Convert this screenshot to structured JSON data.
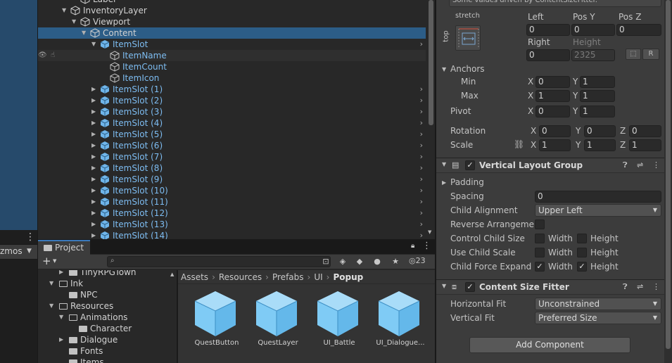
{
  "scene": {
    "gizmos_label": "zmos"
  },
  "hierarchy": {
    "rows": [
      {
        "label": "Label",
        "type": "go",
        "depth": 5,
        "fold": ""
      },
      {
        "label": "InventoryLayer",
        "type": "go",
        "depth": 4,
        "fold": "down"
      },
      {
        "label": "Viewport",
        "type": "go",
        "depth": 5,
        "fold": "down"
      },
      {
        "label": "Content",
        "type": "go",
        "depth": 6,
        "fold": "down",
        "selected": true
      },
      {
        "label": "ItemSlot",
        "type": "prefab",
        "depth": 7,
        "fold": "down",
        "chevron": true
      },
      {
        "label": "ItemName",
        "type": "prefab-child",
        "depth": 8,
        "fold": "",
        "hover": true
      },
      {
        "label": "ItemCount",
        "type": "prefab-child",
        "depth": 8,
        "fold": ""
      },
      {
        "label": "ItemIcon",
        "type": "prefab-child",
        "depth": 8,
        "fold": ""
      },
      {
        "label": "ItemSlot (1)",
        "type": "prefab",
        "depth": 7,
        "fold": "right",
        "chevron": true
      },
      {
        "label": "ItemSlot (2)",
        "type": "prefab",
        "depth": 7,
        "fold": "right",
        "chevron": true
      },
      {
        "label": "ItemSlot (3)",
        "type": "prefab",
        "depth": 7,
        "fold": "right",
        "chevron": true
      },
      {
        "label": "ItemSlot (4)",
        "type": "prefab",
        "depth": 7,
        "fold": "right",
        "chevron": true
      },
      {
        "label": "ItemSlot (5)",
        "type": "prefab",
        "depth": 7,
        "fold": "right",
        "chevron": true
      },
      {
        "label": "ItemSlot (6)",
        "type": "prefab",
        "depth": 7,
        "fold": "right",
        "chevron": true
      },
      {
        "label": "ItemSlot (7)",
        "type": "prefab",
        "depth": 7,
        "fold": "right",
        "chevron": true
      },
      {
        "label": "ItemSlot (8)",
        "type": "prefab",
        "depth": 7,
        "fold": "right",
        "chevron": true
      },
      {
        "label": "ItemSlot (9)",
        "type": "prefab",
        "depth": 7,
        "fold": "right",
        "chevron": true
      },
      {
        "label": "ItemSlot (10)",
        "type": "prefab",
        "depth": 7,
        "fold": "right",
        "chevron": true
      },
      {
        "label": "ItemSlot (11)",
        "type": "prefab",
        "depth": 7,
        "fold": "right",
        "chevron": true
      },
      {
        "label": "ItemSlot (12)",
        "type": "prefab",
        "depth": 7,
        "fold": "right",
        "chevron": true
      },
      {
        "label": "ItemSlot (13)",
        "type": "prefab",
        "depth": 7,
        "fold": "right",
        "chevron": true
      },
      {
        "label": "ItemSlot (14)",
        "type": "prefab",
        "depth": 7,
        "fold": "right",
        "chevron": true
      }
    ]
  },
  "project": {
    "tab_label": "Project",
    "hidden_count": "23",
    "search": {
      "value": "",
      "placeholder": ""
    },
    "tree": [
      {
        "label": "TinyRPGTown",
        "depth": 2,
        "fold": "right"
      },
      {
        "label": "Ink",
        "depth": 1,
        "fold": "down",
        "open": true
      },
      {
        "label": "NPC",
        "depth": 2,
        "fold": ""
      },
      {
        "label": "Resources",
        "depth": 1,
        "fold": "down",
        "open": true
      },
      {
        "label": "Animations",
        "depth": 2,
        "fold": "down",
        "open": true
      },
      {
        "label": "Character",
        "depth": 3,
        "fold": ""
      },
      {
        "label": "Dialogue",
        "depth": 2,
        "fold": "right"
      },
      {
        "label": "Fonts",
        "depth": 2,
        "fold": ""
      },
      {
        "label": "Items",
        "depth": 2,
        "fold": ""
      }
    ],
    "breadcrumbs": [
      "Assets",
      "Resources",
      "Prefabs",
      "UI",
      "Popup"
    ],
    "assets": [
      {
        "label": "QuestButton"
      },
      {
        "label": "QuestLayer"
      },
      {
        "label": "UI_Battle"
      },
      {
        "label": "UI_Dialogue..."
      }
    ]
  },
  "inspector": {
    "top_note": "Some values driven by ContentSizeFitter.",
    "rect": {
      "anchor_preset_h": "stretch",
      "anchor_preset_v": "top",
      "left_label": "Left",
      "left": "0",
      "posy_label": "Pos Y",
      "posy": "0",
      "posz_label": "Pos Z",
      "posz": "0",
      "right_label": "Right",
      "right": "0",
      "height_label": "Height",
      "height": "2325",
      "r_button": "R"
    },
    "anchors": {
      "label": "Anchors",
      "min_label": "Min",
      "min_x": "0",
      "min_y": "1",
      "max_label": "Max",
      "max_x": "1",
      "max_y": "1"
    },
    "pivot": {
      "label": "Pivot",
      "x": "0",
      "y": "1"
    },
    "rotation": {
      "label": "Rotation",
      "x": "0",
      "y": "0",
      "z": "0"
    },
    "scale": {
      "label": "Scale",
      "x": "1",
      "y": "1",
      "z": "1"
    },
    "axis": {
      "x": "X",
      "y": "Y",
      "z": "Z"
    },
    "vlg": {
      "title": "Vertical Layout Group",
      "padding_label": "Padding",
      "spacing_label": "Spacing",
      "spacing": "0",
      "child_alignment_label": "Child Alignment",
      "child_alignment": "Upper Left",
      "reverse_label": "Reverse Arrangement",
      "control_size_label": "Control Child Size",
      "use_scale_label": "Use Child Scale",
      "force_expand_label": "Child Force Expand",
      "width_label": "Width",
      "height_label": "Height"
    },
    "csf": {
      "title": "Content Size Fitter",
      "hfit_label": "Horizontal Fit",
      "hfit": "Unconstrained",
      "vfit_label": "Vertical Fit",
      "vfit": "Preferred Size"
    },
    "add_component": "Add Component"
  },
  "colors": {
    "prefab_text": "#7dbcf1",
    "selection": "#2c5d87",
    "panel": "#282828",
    "inspector": "#3c3c3c"
  }
}
